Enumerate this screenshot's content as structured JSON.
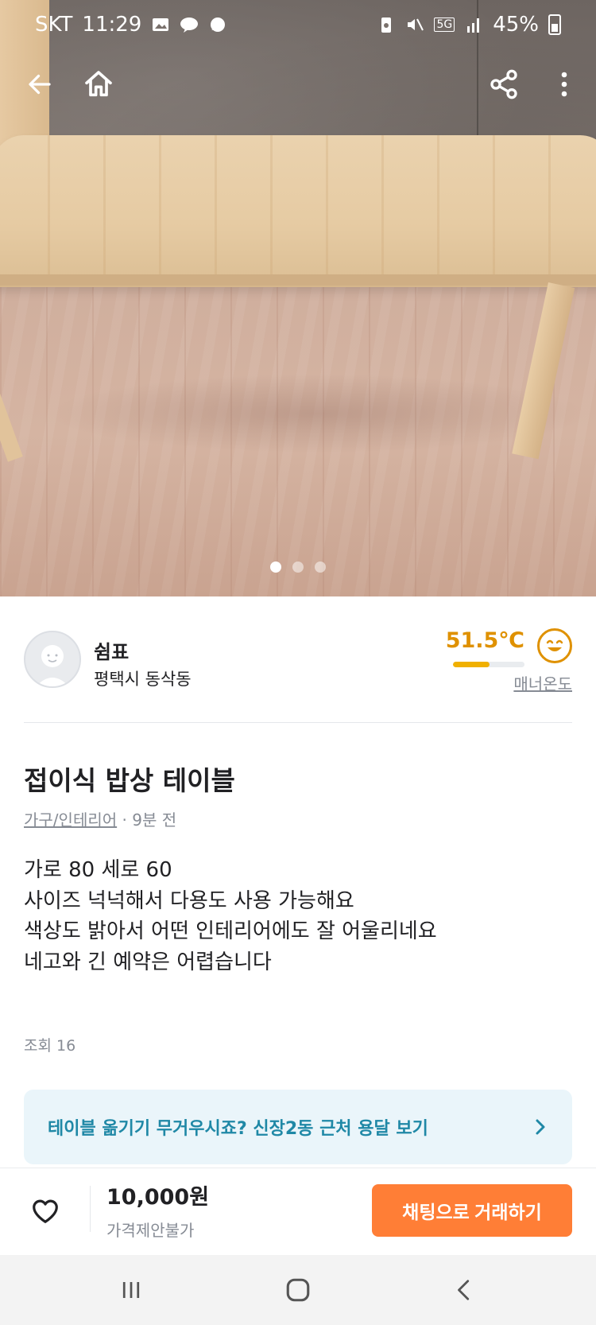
{
  "status_bar": {
    "carrier": "SKT",
    "time": "11:29",
    "battery": "45%",
    "network": "5G"
  },
  "app_bar": {
    "back_icon": "back-arrow-icon",
    "home_icon": "home-icon",
    "share_icon": "share-icon",
    "more_icon": "more-vertical-icon"
  },
  "gallery": {
    "image_count": 3,
    "active_index": 0
  },
  "seller": {
    "name": "쉼표",
    "location": "평택시 동삭동",
    "temperature": "51.5℃",
    "temperature_level": 0.515,
    "manner_label": "매너온도"
  },
  "post": {
    "title": "접이식 밥상 테이블",
    "category": "가구/인테리어",
    "time_ago": "· 9분 전",
    "description_lines": [
      "가로 80 세로 60",
      "사이즈 넉넉해서 다용도 사용 가능해요",
      "색상도 밝아서 어떤 인테리어에도 잘 어울리네요",
      "네고와 긴 예약은 어렵습니다"
    ],
    "views": "조회 16"
  },
  "banner": {
    "text": "테이블 옮기기 무거우시죠? 신장2동 근처 용달 보기",
    "chevron": "›"
  },
  "bottom_bar": {
    "price": "10,000원",
    "negotiation": "가격제안불가",
    "chat_button": "채팅으로 거래하기"
  },
  "colors": {
    "accent": "#ff7e36",
    "temperature": "#df9100",
    "banner_text": "#1f88a6",
    "banner_bg": "#eaf5fa"
  }
}
